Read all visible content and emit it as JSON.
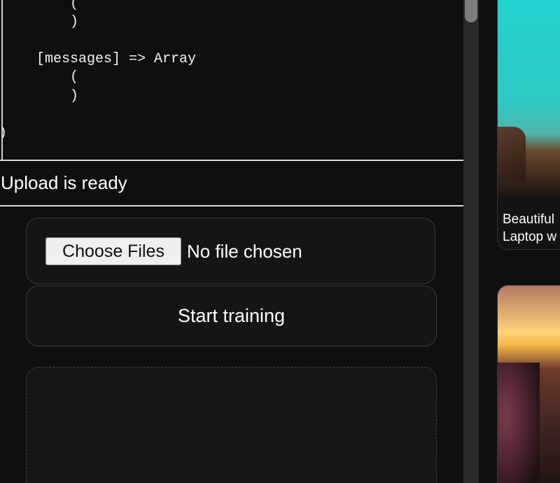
{
  "code_output": {
    "lines": [
      {
        "text": "        ("
      },
      {
        "text": "        )"
      },
      {
        "text": ""
      },
      {
        "text": "    [messages] => Array"
      },
      {
        "text": "        ("
      },
      {
        "text": "        )"
      },
      {
        "text": ""
      },
      {
        "text": ")"
      }
    ]
  },
  "status": {
    "text": "Upload is ready"
  },
  "file_input": {
    "button_label": "Choose Files",
    "status": "No file chosen"
  },
  "train_button": {
    "label": "Start training"
  },
  "right_cards": [
    {
      "caption_line1": "Beautiful",
      "caption_line2": "Laptop w"
    }
  ]
}
